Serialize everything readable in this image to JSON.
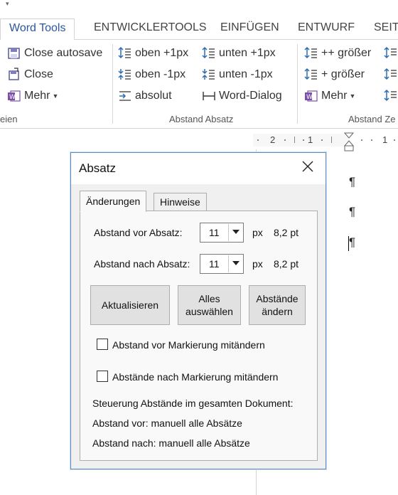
{
  "ribbon": {
    "tabs": [
      {
        "label": "Word Tools",
        "active": true
      },
      {
        "label": "ENTWICKLERTOOLS"
      },
      {
        "label": "EINFÜGEN"
      },
      {
        "label": "ENTWURF"
      },
      {
        "label": "SEITI"
      }
    ],
    "group1": {
      "items": [
        "Close autosave",
        "Close",
        "Mehr"
      ],
      "label": "eien"
    },
    "group2": {
      "items": [
        "oben +1px",
        "oben -1px",
        "absolut",
        "unten +1px",
        "unten -1px",
        "Word-Dialog"
      ],
      "label": "Abstand Absatz"
    },
    "group3": {
      "items": [
        "++ größer",
        "+ größer",
        "Mehr"
      ],
      "label": "Abstand Ze"
    }
  },
  "ruler": {
    "numbers": [
      "2",
      "1",
      "1"
    ]
  },
  "document": {
    "pilcrow": "¶"
  },
  "dialog": {
    "title": "Absatz",
    "tabs": [
      "Änderungen",
      "Hinweise"
    ],
    "before_label": "Abstand vor Absatz:",
    "after_label": "Abstand nach Absatz:",
    "before_value": "11",
    "after_value": "11",
    "unit": "px",
    "before_pt": "8,2 pt",
    "after_pt": "8,2 pt",
    "buttons": {
      "update": "Aktualisieren",
      "select_all_1": "Alles",
      "select_all_2": "auswählen",
      "change_1": "Abstände",
      "change_2": "ändern"
    },
    "checkbox_before": "Abstand vor Markierung mitändern",
    "checkbox_after": "Abstände nach Markierung mitändern",
    "info_heading": "Steuerung Abstände im gesamten Dokument:",
    "info_before": "Abstand vor: manuell alle Absätze",
    "info_after": "Abstand nach: manuell alle Absätze"
  },
  "colors": {
    "accent": "#2b579a",
    "dialog_border": "#5b8cc4"
  }
}
